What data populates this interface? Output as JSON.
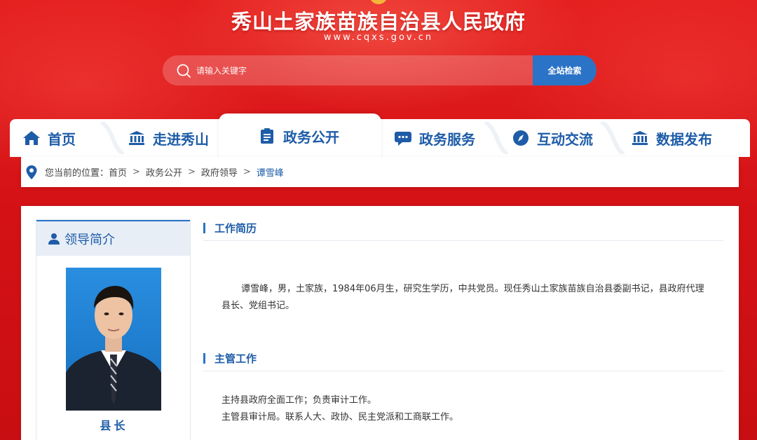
{
  "header": {
    "site_title": "秀山土家族苗族自治县人民政府",
    "site_url": "www.cqxs.gov.cn"
  },
  "search": {
    "placeholder": "请输入关键字",
    "button_label": "全站检索"
  },
  "nav": {
    "items": [
      {
        "label": "首页",
        "icon": "home-icon"
      },
      {
        "label": "走进秀山",
        "icon": "landmark-icon"
      },
      {
        "label": "政务公开",
        "icon": "clipboard-icon",
        "active": true
      },
      {
        "label": "政务服务",
        "icon": "chat-icon"
      },
      {
        "label": "互动交流",
        "icon": "compass-icon"
      },
      {
        "label": "数据发布",
        "icon": "bank-icon"
      }
    ]
  },
  "breadcrumb": {
    "prefix": "您当前的位置：",
    "items": [
      "首页",
      "政务公开",
      "政府领导",
      "谭雪峰"
    ],
    "separator": ">"
  },
  "leader": {
    "panel_title": "领导简介",
    "role": "县长"
  },
  "sections": {
    "resume": {
      "title": "工作简历",
      "text": "谭雪峰，男，土家族，1984年06月生，研究生学历，中共党员。现任秀山土家族苗族自治县委副书记，县政府代理县长、党组书记。"
    },
    "duties": {
      "title": "主管工作",
      "lines": [
        "主持县政府全面工作；负责审计工作。",
        "主管县审计局。联系人大、政协、民主党派和工商联工作。"
      ]
    }
  },
  "colors": {
    "brand_red": "#d7141a",
    "accent_blue": "#1e5ca8",
    "button_blue": "#2b73c6"
  }
}
